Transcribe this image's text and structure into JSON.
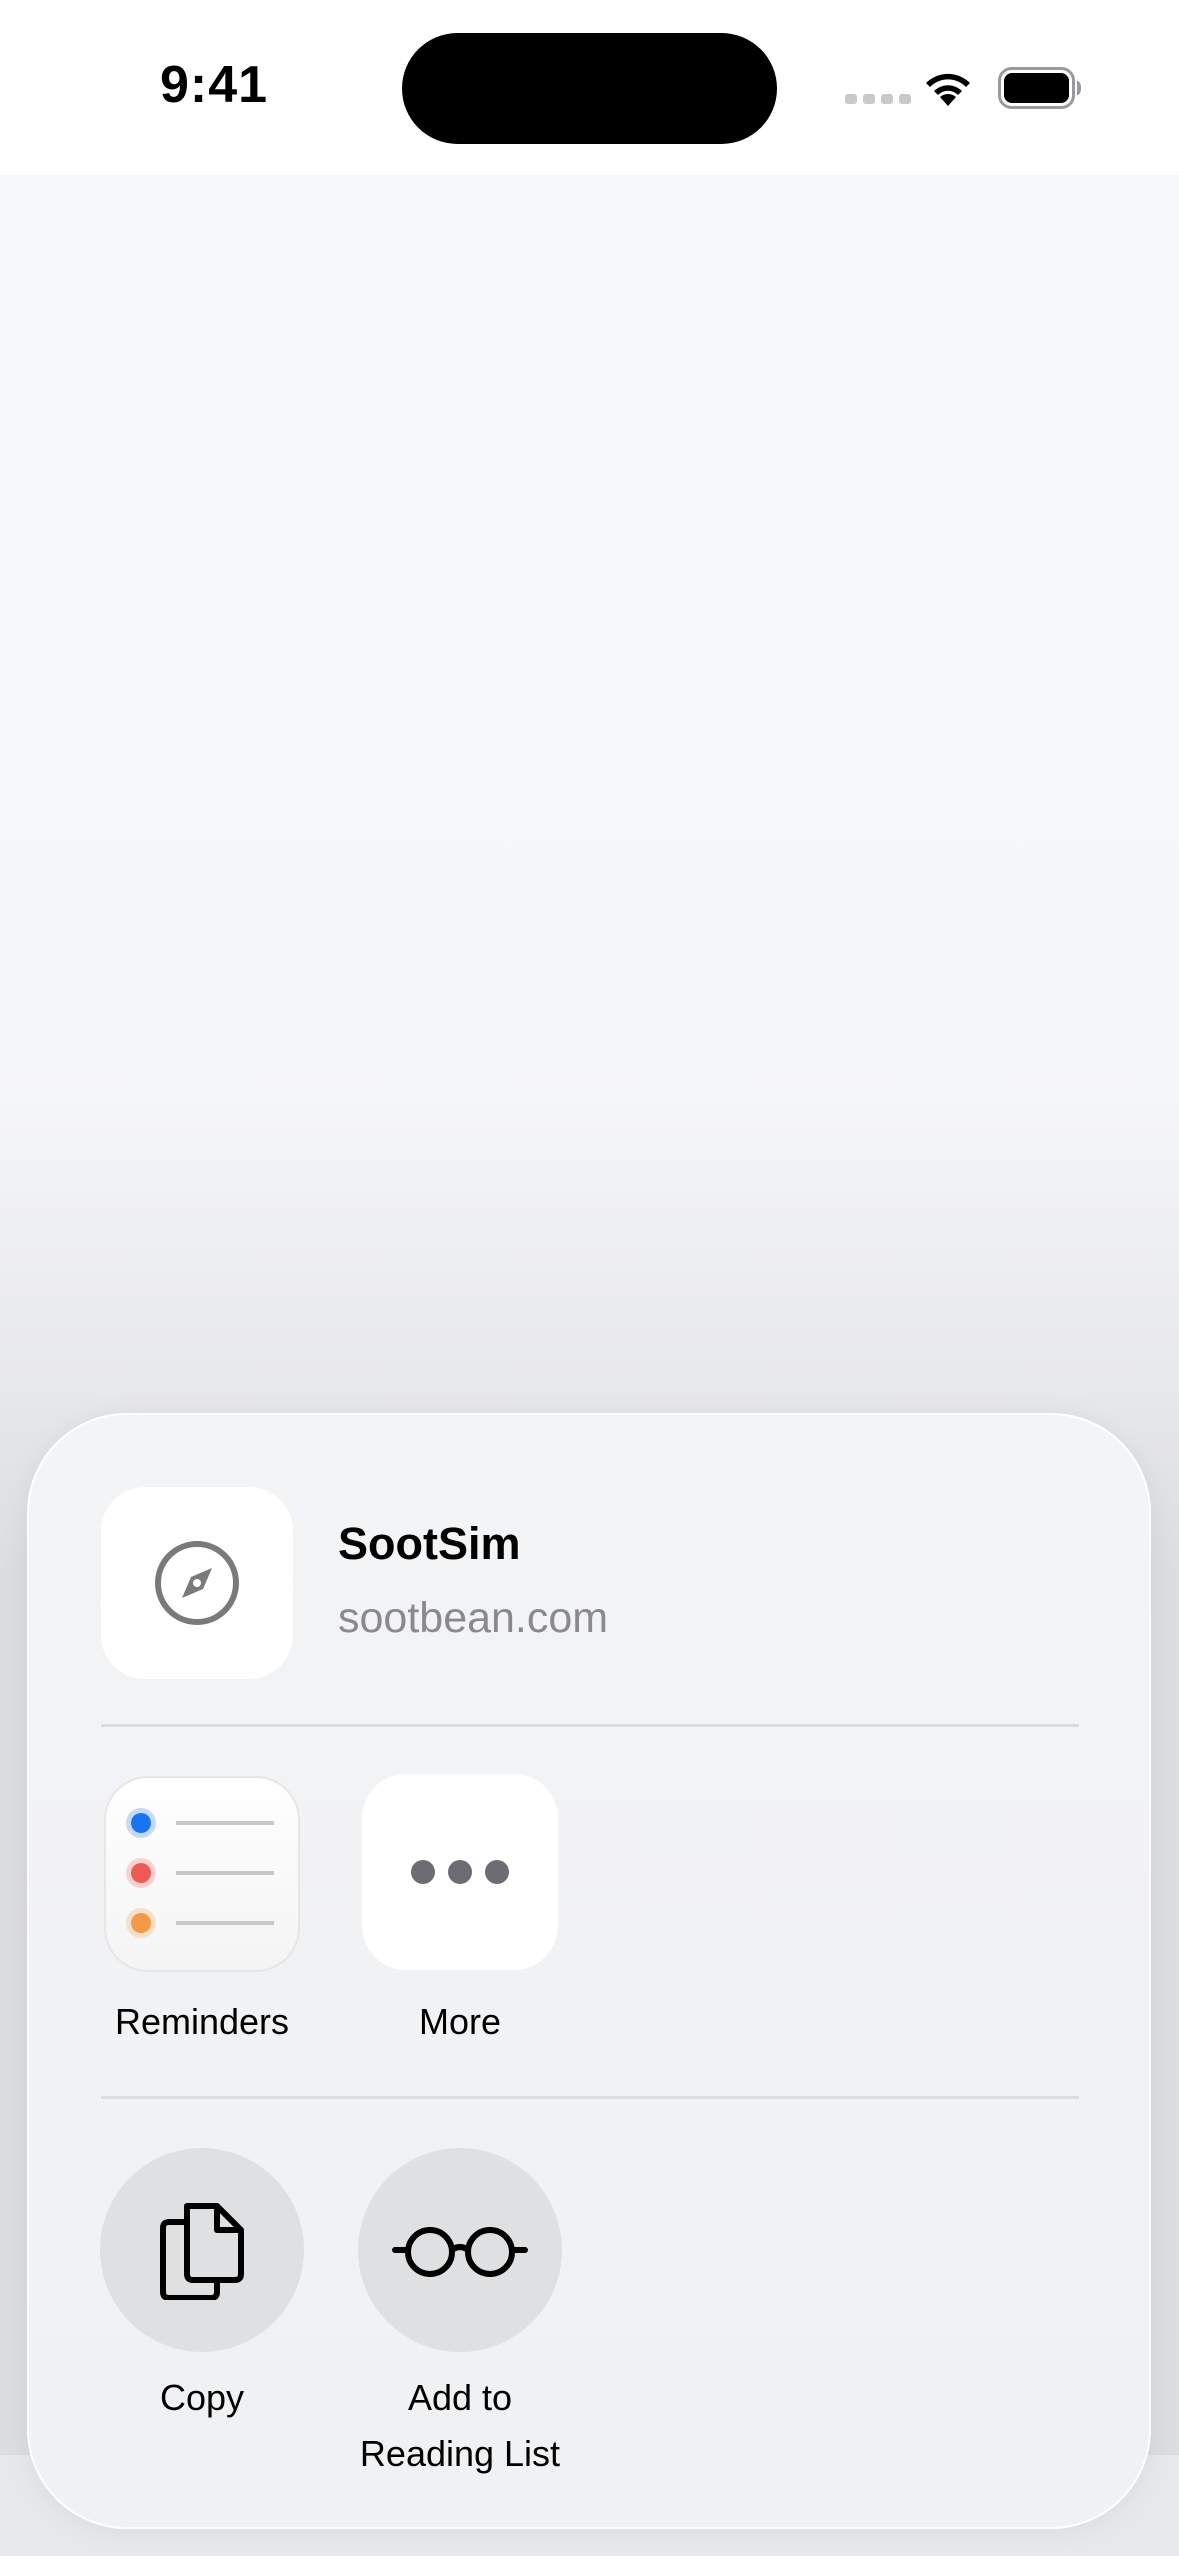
{
  "status": {
    "time": "9:41"
  },
  "share": {
    "title": "SootSim",
    "subtitle": "sootbean.com",
    "apps": [
      {
        "label": "Reminders",
        "icon": "reminders-icon"
      },
      {
        "label": "More",
        "icon": "more-icon"
      }
    ],
    "actions": [
      {
        "label": "Copy",
        "icon": "copy-icon"
      },
      {
        "label_line1": "Add to",
        "label_line2": "Reading List",
        "icon": "glasses-icon"
      }
    ]
  },
  "colors": {
    "reminder_blue": "#1a73f0",
    "reminder_red": "#ee5a55",
    "reminder_orange": "#f29a45",
    "more_dots": "#6c6c73",
    "subtitle_gray": "#8a8a8e"
  }
}
